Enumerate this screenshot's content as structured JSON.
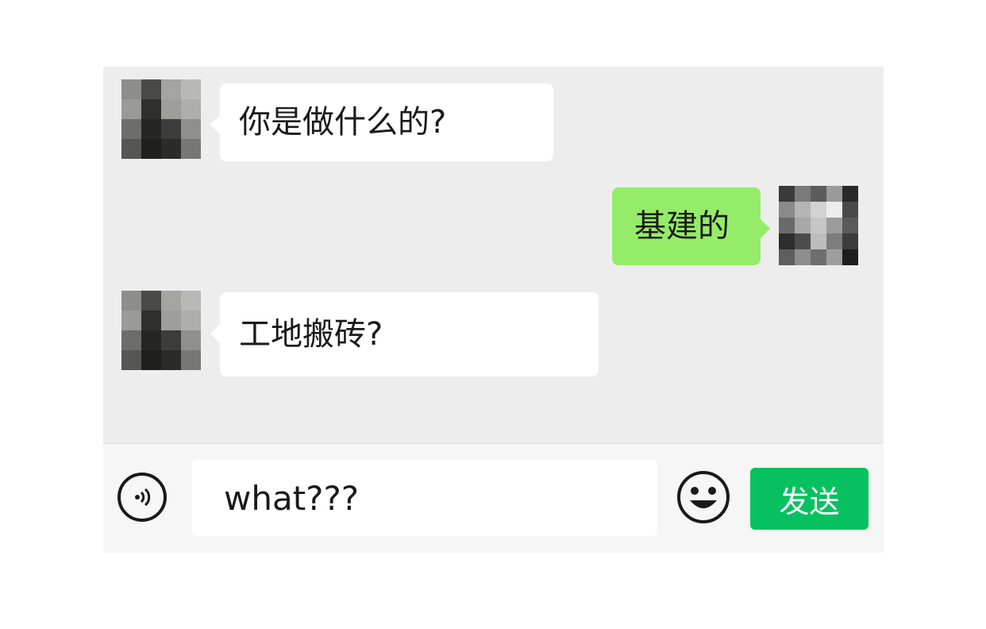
{
  "chat": {
    "messages": [
      {
        "direction": "incoming",
        "text": "你是做什么的?",
        "avatar_icon": "pixelated-avatar-icon"
      },
      {
        "direction": "outgoing",
        "text": "基建的",
        "avatar_icon": "pixelated-avatar-icon"
      },
      {
        "direction": "incoming",
        "text": "工地搬砖?",
        "avatar_icon": "pixelated-avatar-icon"
      }
    ]
  },
  "input_bar": {
    "voice_icon": "voice-input-icon",
    "text_value": "what???",
    "emoji_icon": "emoji-smile-icon",
    "send_label": "发送"
  },
  "colors": {
    "chat_background": "#ededed",
    "incoming_bubble": "#ffffff",
    "outgoing_bubble": "#95ec69",
    "send_button": "#07c160"
  }
}
